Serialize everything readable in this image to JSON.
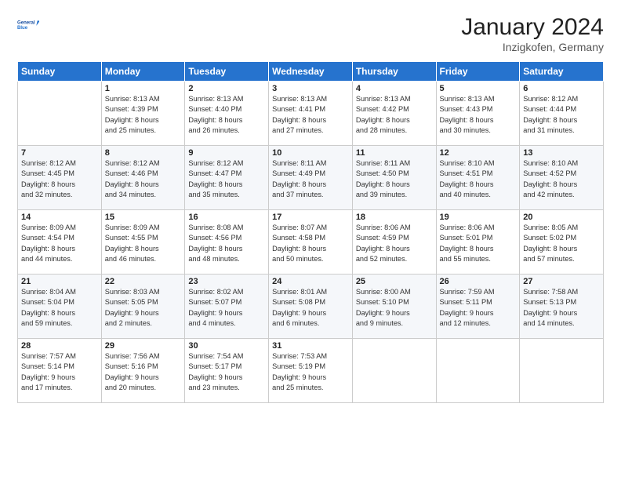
{
  "header": {
    "logo_line1": "General",
    "logo_line2": "Blue",
    "month_title": "January 2024",
    "location": "Inzigkofen, Germany"
  },
  "weekdays": [
    "Sunday",
    "Monday",
    "Tuesday",
    "Wednesday",
    "Thursday",
    "Friday",
    "Saturday"
  ],
  "weeks": [
    [
      {
        "day": "",
        "text": ""
      },
      {
        "day": "1",
        "text": "Sunrise: 8:13 AM\nSunset: 4:39 PM\nDaylight: 8 hours\nand 25 minutes."
      },
      {
        "day": "2",
        "text": "Sunrise: 8:13 AM\nSunset: 4:40 PM\nDaylight: 8 hours\nand 26 minutes."
      },
      {
        "day": "3",
        "text": "Sunrise: 8:13 AM\nSunset: 4:41 PM\nDaylight: 8 hours\nand 27 minutes."
      },
      {
        "day": "4",
        "text": "Sunrise: 8:13 AM\nSunset: 4:42 PM\nDaylight: 8 hours\nand 28 minutes."
      },
      {
        "day": "5",
        "text": "Sunrise: 8:13 AM\nSunset: 4:43 PM\nDaylight: 8 hours\nand 30 minutes."
      },
      {
        "day": "6",
        "text": "Sunrise: 8:12 AM\nSunset: 4:44 PM\nDaylight: 8 hours\nand 31 minutes."
      }
    ],
    [
      {
        "day": "7",
        "text": "Sunrise: 8:12 AM\nSunset: 4:45 PM\nDaylight: 8 hours\nand 32 minutes."
      },
      {
        "day": "8",
        "text": "Sunrise: 8:12 AM\nSunset: 4:46 PM\nDaylight: 8 hours\nand 34 minutes."
      },
      {
        "day": "9",
        "text": "Sunrise: 8:12 AM\nSunset: 4:47 PM\nDaylight: 8 hours\nand 35 minutes."
      },
      {
        "day": "10",
        "text": "Sunrise: 8:11 AM\nSunset: 4:49 PM\nDaylight: 8 hours\nand 37 minutes."
      },
      {
        "day": "11",
        "text": "Sunrise: 8:11 AM\nSunset: 4:50 PM\nDaylight: 8 hours\nand 39 minutes."
      },
      {
        "day": "12",
        "text": "Sunrise: 8:10 AM\nSunset: 4:51 PM\nDaylight: 8 hours\nand 40 minutes."
      },
      {
        "day": "13",
        "text": "Sunrise: 8:10 AM\nSunset: 4:52 PM\nDaylight: 8 hours\nand 42 minutes."
      }
    ],
    [
      {
        "day": "14",
        "text": "Sunrise: 8:09 AM\nSunset: 4:54 PM\nDaylight: 8 hours\nand 44 minutes."
      },
      {
        "day": "15",
        "text": "Sunrise: 8:09 AM\nSunset: 4:55 PM\nDaylight: 8 hours\nand 46 minutes."
      },
      {
        "day": "16",
        "text": "Sunrise: 8:08 AM\nSunset: 4:56 PM\nDaylight: 8 hours\nand 48 minutes."
      },
      {
        "day": "17",
        "text": "Sunrise: 8:07 AM\nSunset: 4:58 PM\nDaylight: 8 hours\nand 50 minutes."
      },
      {
        "day": "18",
        "text": "Sunrise: 8:06 AM\nSunset: 4:59 PM\nDaylight: 8 hours\nand 52 minutes."
      },
      {
        "day": "19",
        "text": "Sunrise: 8:06 AM\nSunset: 5:01 PM\nDaylight: 8 hours\nand 55 minutes."
      },
      {
        "day": "20",
        "text": "Sunrise: 8:05 AM\nSunset: 5:02 PM\nDaylight: 8 hours\nand 57 minutes."
      }
    ],
    [
      {
        "day": "21",
        "text": "Sunrise: 8:04 AM\nSunset: 5:04 PM\nDaylight: 8 hours\nand 59 minutes."
      },
      {
        "day": "22",
        "text": "Sunrise: 8:03 AM\nSunset: 5:05 PM\nDaylight: 9 hours\nand 2 minutes."
      },
      {
        "day": "23",
        "text": "Sunrise: 8:02 AM\nSunset: 5:07 PM\nDaylight: 9 hours\nand 4 minutes."
      },
      {
        "day": "24",
        "text": "Sunrise: 8:01 AM\nSunset: 5:08 PM\nDaylight: 9 hours\nand 6 minutes."
      },
      {
        "day": "25",
        "text": "Sunrise: 8:00 AM\nSunset: 5:10 PM\nDaylight: 9 hours\nand 9 minutes."
      },
      {
        "day": "26",
        "text": "Sunrise: 7:59 AM\nSunset: 5:11 PM\nDaylight: 9 hours\nand 12 minutes."
      },
      {
        "day": "27",
        "text": "Sunrise: 7:58 AM\nSunset: 5:13 PM\nDaylight: 9 hours\nand 14 minutes."
      }
    ],
    [
      {
        "day": "28",
        "text": "Sunrise: 7:57 AM\nSunset: 5:14 PM\nDaylight: 9 hours\nand 17 minutes."
      },
      {
        "day": "29",
        "text": "Sunrise: 7:56 AM\nSunset: 5:16 PM\nDaylight: 9 hours\nand 20 minutes."
      },
      {
        "day": "30",
        "text": "Sunrise: 7:54 AM\nSunset: 5:17 PM\nDaylight: 9 hours\nand 23 minutes."
      },
      {
        "day": "31",
        "text": "Sunrise: 7:53 AM\nSunset: 5:19 PM\nDaylight: 9 hours\nand 25 minutes."
      },
      {
        "day": "",
        "text": ""
      },
      {
        "day": "",
        "text": ""
      },
      {
        "day": "",
        "text": ""
      }
    ]
  ]
}
